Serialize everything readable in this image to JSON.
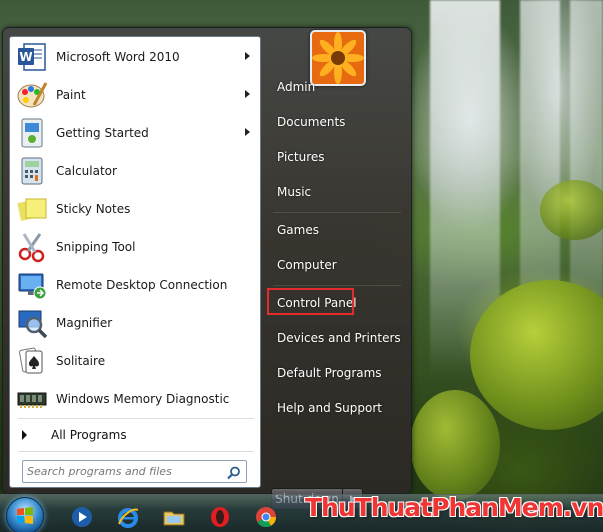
{
  "programs": [
    {
      "label": "Microsoft Word 2010",
      "icon": "word-icon",
      "has_submenu": true
    },
    {
      "label": "Paint",
      "icon": "paint-icon",
      "has_submenu": true
    },
    {
      "label": "Getting Started",
      "icon": "getting-started-icon",
      "has_submenu": true
    },
    {
      "label": "Calculator",
      "icon": "calculator-icon",
      "has_submenu": false
    },
    {
      "label": "Sticky Notes",
      "icon": "sticky-notes-icon",
      "has_submenu": false
    },
    {
      "label": "Snipping Tool",
      "icon": "scissors-icon",
      "has_submenu": false
    },
    {
      "label": "Remote Desktop Connection",
      "icon": "remote-desktop-icon",
      "has_submenu": false
    },
    {
      "label": "Magnifier",
      "icon": "magnifier-icon",
      "has_submenu": false
    },
    {
      "label": "Solitaire",
      "icon": "playing-card-icon",
      "has_submenu": false
    },
    {
      "label": "Windows Memory Diagnostic",
      "icon": "memory-chip-icon",
      "has_submenu": false
    }
  ],
  "all_programs_label": "All Programs",
  "search": {
    "placeholder": "Search programs and files"
  },
  "right_menu": [
    "Admin",
    "Documents",
    "Pictures",
    "Music",
    "Games",
    "Computer",
    "Control Panel",
    "Devices and Printers",
    "Default Programs",
    "Help and Support"
  ],
  "highlighted_item": "Control Panel",
  "shutdown_label": "Shut down",
  "watermark": "ThuThuatPhanMem.vn",
  "colors": {
    "highlight": "#e52c2c",
    "watermark": "#f03535"
  }
}
